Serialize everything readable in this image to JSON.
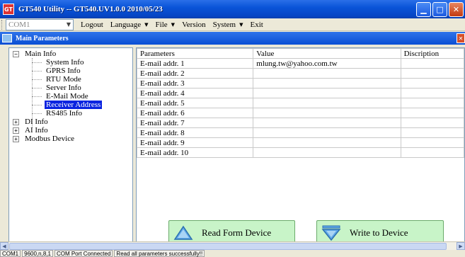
{
  "window": {
    "title": "GT540 Utility -- GT540.UV1.0.0 2010/05/23",
    "app_icon_text": "GT"
  },
  "menubar": {
    "port_select": {
      "value": "COM1",
      "enabled": false
    },
    "items": [
      {
        "label": "Logout",
        "has_menu": false
      },
      {
        "label": "Language",
        "has_menu": true
      },
      {
        "label": "File",
        "has_menu": true
      },
      {
        "label": "Version",
        "has_menu": false
      },
      {
        "label": "System",
        "has_menu": true
      },
      {
        "label": "Exit",
        "has_menu": false
      }
    ]
  },
  "child_window": {
    "title": "Main Parameters"
  },
  "tree": {
    "main_info": {
      "label": "Main Info",
      "toggle": "−"
    },
    "children": [
      {
        "label": "System Info",
        "selected": false
      },
      {
        "label": "GPRS Info",
        "selected": false
      },
      {
        "label": "RTU Mode",
        "selected": false
      },
      {
        "label": "Server Info",
        "selected": false
      },
      {
        "label": "E-Mail Mode",
        "selected": false
      },
      {
        "label": "Receiver Address",
        "selected": true
      },
      {
        "label": "RS485 Info",
        "selected": false
      }
    ],
    "collapsed": [
      {
        "label": "DI Info",
        "toggle": "+"
      },
      {
        "label": "AI Info",
        "toggle": "+"
      },
      {
        "label": "Modbus Device",
        "toggle": "+"
      }
    ]
  },
  "grid": {
    "columns": [
      "Parameters",
      "Value",
      "Discription"
    ],
    "rows": [
      {
        "param": "E-mail addr. 1",
        "value": "mlung.tw@yahoo.com.tw",
        "desc": ""
      },
      {
        "param": "E-mail addr. 2",
        "value": "",
        "desc": ""
      },
      {
        "param": "E-mail addr. 3",
        "value": "",
        "desc": ""
      },
      {
        "param": "E-mail addr. 4",
        "value": "",
        "desc": ""
      },
      {
        "param": "E-mail addr. 5",
        "value": "",
        "desc": ""
      },
      {
        "param": "E-mail addr. 6",
        "value": "",
        "desc": ""
      },
      {
        "param": "E-mail addr. 7",
        "value": "",
        "desc": ""
      },
      {
        "param": "E-mail addr. 8",
        "value": "",
        "desc": ""
      },
      {
        "param": "E-mail addr. 9",
        "value": "",
        "desc": ""
      },
      {
        "param": "E-mail addr. 10",
        "value": "",
        "desc": ""
      }
    ]
  },
  "buttons": {
    "read": {
      "label": "Read Form Device",
      "icon": "triangle-up-icon"
    },
    "write": {
      "label": "Write to Device",
      "icon": "triangle-down-icon"
    }
  },
  "statusbar": {
    "port": "COM1",
    "settings": "9600,n,8,1",
    "connection": "COM Port Connected",
    "message": "Read all parameters successfully!!"
  },
  "colors": {
    "button_bg": "#c8f4c8",
    "selection": "#0a24e0",
    "titlebar": "#0a54d8"
  }
}
